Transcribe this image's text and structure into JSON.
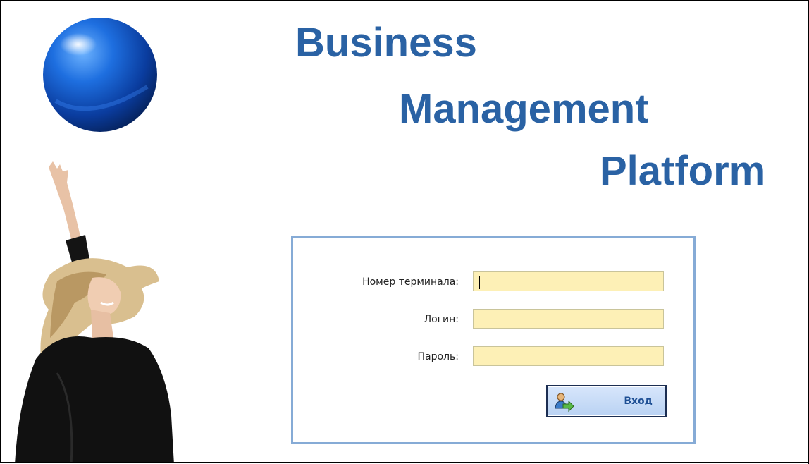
{
  "header": {
    "title_line_1": "Business",
    "title_line_2": "Management",
    "title_line_3": "Platform"
  },
  "login_form": {
    "terminal_label": "Номер терминала:",
    "terminal_value": "",
    "login_label": "Логин:",
    "login_value": "",
    "password_label": "Пароль:",
    "password_value": "",
    "submit_label": "Вход",
    "submit_icon": "user-login-icon"
  },
  "colors": {
    "brand_blue": "#2a62a4",
    "input_background": "#fdf0b6",
    "form_border": "#86abd6"
  },
  "images": {
    "logo": "blue-sphere-logo",
    "hero": "woman-reaching-up-photo"
  }
}
